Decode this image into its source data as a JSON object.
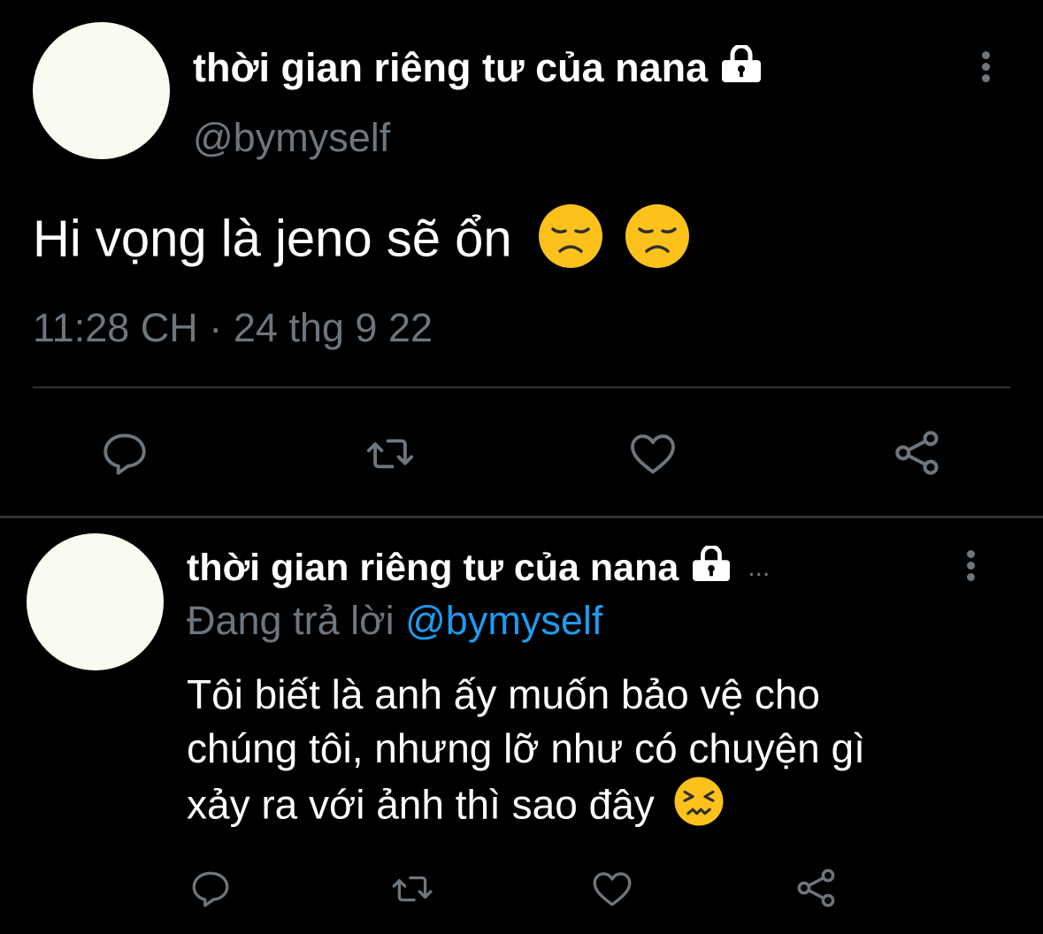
{
  "main_tweet": {
    "display_name": "thời gian riêng tư của nana",
    "lock_icon": "lock-icon",
    "handle": "@bymyself",
    "text": "Hi vọng là jeno sẽ ổn",
    "emojis": [
      "disappointed-face-emoji",
      "disappointed-face-emoji"
    ],
    "time": "11:28 CH",
    "separator": "·",
    "date": "24 thg 9 22",
    "actions": [
      "reply-icon",
      "retweet-icon",
      "like-icon",
      "share-icon"
    ]
  },
  "reply_tweet": {
    "display_name": "thời gian riêng tư của nana",
    "lock_icon": "lock-icon",
    "truncation": "...",
    "replying_label": "Đang trả lời",
    "replying_handle": "@bymyself",
    "text_line1": "Tôi biết là anh ấy muốn bảo vệ cho",
    "text_line2": "chúng tôi, nhưng lỡ như có chuyện gì",
    "text_line3": "xảy ra với ảnh thì sao đây",
    "emoji": "confounded-face-emoji",
    "actions": [
      "reply-icon",
      "retweet-icon",
      "like-icon",
      "share-icon"
    ]
  },
  "colors": {
    "background": "#000000",
    "primary_text": "#ffffff",
    "secondary_text": "#6e767d",
    "link": "#1d9bf0",
    "divider": "#2f3336",
    "avatar": "#fafaf0"
  }
}
